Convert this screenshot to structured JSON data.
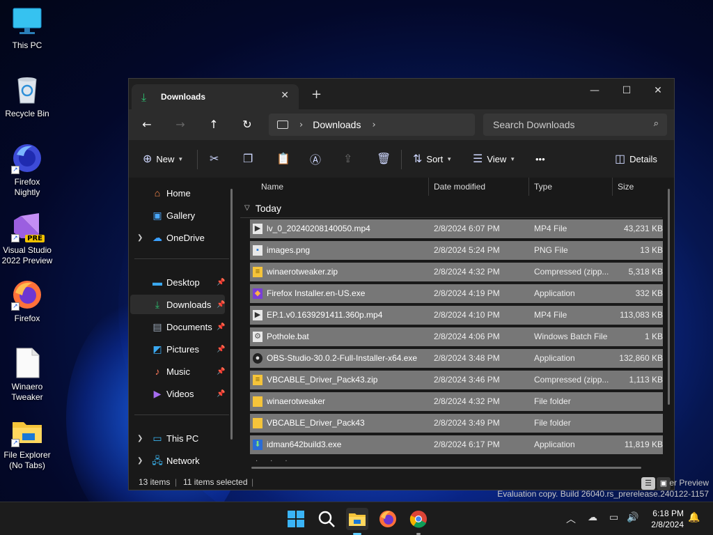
{
  "desktop": {
    "icons": [
      {
        "label": "This PC",
        "icon": "monitor-icon"
      },
      {
        "label": "Recycle Bin",
        "icon": "recycle-bin-icon"
      },
      {
        "label": "Firefox Nightly",
        "icon": "firefox-nightly-icon"
      },
      {
        "label": "Visual Studio 2022 Preview",
        "icon": "visual-studio-icon",
        "badge": "PRE"
      },
      {
        "label": "Firefox",
        "icon": "firefox-icon"
      },
      {
        "label": "Winaero Tweaker",
        "icon": "document-icon"
      },
      {
        "label": "File Explorer (No Tabs)",
        "icon": "folder-icon"
      }
    ]
  },
  "window": {
    "tab_title": "Downloads",
    "tab_close": "✕",
    "new_tab": "+",
    "controls": {
      "minimize": "—",
      "maximize": "☐",
      "close": "✕"
    }
  },
  "address": {
    "back": "←",
    "forward": "→",
    "up": "↑",
    "refresh": "↻",
    "current": "Downloads",
    "search_placeholder": "Search Downloads"
  },
  "toolbar": {
    "new_label": "New",
    "sort_label": "Sort",
    "view_label": "View",
    "more_label": "•••",
    "details_label": "Details"
  },
  "nav": {
    "items": [
      {
        "label": "Home",
        "icon": "home-icon"
      },
      {
        "label": "Gallery",
        "icon": "gallery-icon"
      },
      {
        "label": "OneDrive",
        "icon": "cloud-icon"
      },
      {
        "label": "Desktop",
        "icon": "desktop-icon"
      },
      {
        "label": "Downloads",
        "icon": "download-icon"
      },
      {
        "label": "Documents",
        "icon": "documents-icon"
      },
      {
        "label": "Pictures",
        "icon": "pictures-icon"
      },
      {
        "label": "Music",
        "icon": "music-icon"
      },
      {
        "label": "Videos",
        "icon": "videos-icon"
      },
      {
        "label": "This PC",
        "icon": "monitor-icon"
      },
      {
        "label": "Network",
        "icon": "network-icon"
      }
    ]
  },
  "columns": {
    "name": "Name",
    "date": "Date modified",
    "type": "Type",
    "size": "Size"
  },
  "group_label": "Today",
  "files": [
    {
      "name": "lv_0_20240208140050.mp4",
      "date": "2/8/2024 6:07 PM",
      "type": "MP4 File",
      "size": "43,231 KB",
      "icon": "video-file-icon"
    },
    {
      "name": "images.png",
      "date": "2/8/2024 5:24 PM",
      "type": "PNG File",
      "size": "13 KB",
      "icon": "image-file-icon"
    },
    {
      "name": "winaerotweaker.zip",
      "date": "2/8/2024 4:32 PM",
      "type": "Compressed (zipp...",
      "size": "5,318 KB",
      "icon": "zip-file-icon"
    },
    {
      "name": "Firefox Installer.en-US.exe",
      "date": "2/8/2024 4:19 PM",
      "type": "Application",
      "size": "332 KB",
      "icon": "firefox-installer-icon"
    },
    {
      "name": "EP.1.v0.1639291411.360p.mp4",
      "date": "2/8/2024 4:10 PM",
      "type": "MP4 File",
      "size": "113,083 KB",
      "icon": "video-file-icon"
    },
    {
      "name": "Pothole.bat",
      "date": "2/8/2024 4:06 PM",
      "type": "Windows Batch File",
      "size": "1 KB",
      "icon": "batch-file-icon"
    },
    {
      "name": "OBS-Studio-30.0.2-Full-Installer-x64.exe",
      "date": "2/8/2024 3:48 PM",
      "type": "Application",
      "size": "132,860 KB",
      "icon": "obs-icon"
    },
    {
      "name": "VBCABLE_Driver_Pack43.zip",
      "date": "2/8/2024 3:46 PM",
      "type": "Compressed (zipp...",
      "size": "1,113 KB",
      "icon": "zip-file-icon"
    },
    {
      "name": "winaerotweaker",
      "date": "2/8/2024 4:32 PM",
      "type": "File folder",
      "size": "",
      "icon": "folder-icon"
    },
    {
      "name": "VBCABLE_Driver_Pack43",
      "date": "2/8/2024 3:49 PM",
      "type": "File folder",
      "size": "",
      "icon": "folder-icon"
    },
    {
      "name": "idman642build3.exe",
      "date": "2/8/2024 6:17 PM",
      "type": "Application",
      "size": "11,819 KB",
      "icon": "idm-icon"
    }
  ],
  "status": {
    "items": "13 items",
    "selected": "11 items selected",
    "sep": "|"
  },
  "watermark": {
    "line1": "er Preview",
    "line2": "Evaluation copy. Build 26040.rs_prerelease.240122-1157"
  },
  "taskbar": {
    "time": "6:18 PM",
    "date": "2/8/2024"
  }
}
